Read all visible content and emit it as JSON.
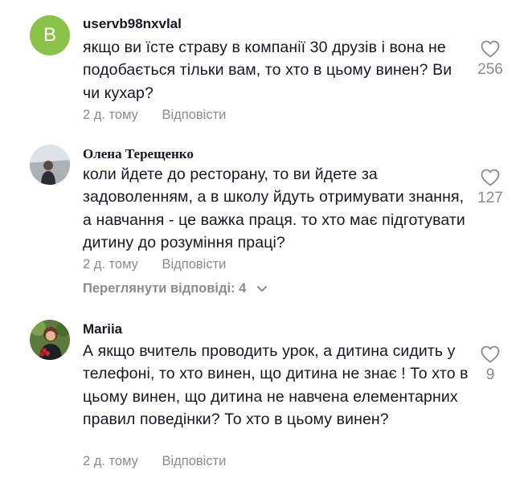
{
  "comments": [
    {
      "username": "uservb98nxvlal",
      "avatar_letter": "B",
      "text": "якщо ви їсте страву в компанії 30 друзів і вона не подобається тільки вам, то хто в цьому винен? Ви чи кухар?",
      "time": "2 д. тому",
      "reply_label": "Відповісти",
      "likes": "256"
    },
    {
      "username": "Олена Терещенко",
      "text": "коли йдете до ресторану, то ви йдете за задоволенням, а в школу йдуть отримувати знання, а навчання - це важка праця. то хто має підготувати дитину до розуміння праці?",
      "time": "2 д. тому",
      "reply_label": "Відповісти",
      "likes": "127",
      "view_replies": "Переглянути відповіді: 4"
    },
    {
      "username": "Mariia",
      "text": "А якщо вчитель проводить урок, а дитина сидить у телефоні, то хто винен, що дитина не знає ! То хто в цьому винен, що дитина не навчена елементарних правил поведінки? То хто в цьому винен?",
      "time": "2 д. тому",
      "reply_label": "Відповісти",
      "likes": "9"
    }
  ],
  "colors": {
    "avatar_b": "#8bc34a",
    "muted": "#8a8b91",
    "text": "#161823"
  }
}
